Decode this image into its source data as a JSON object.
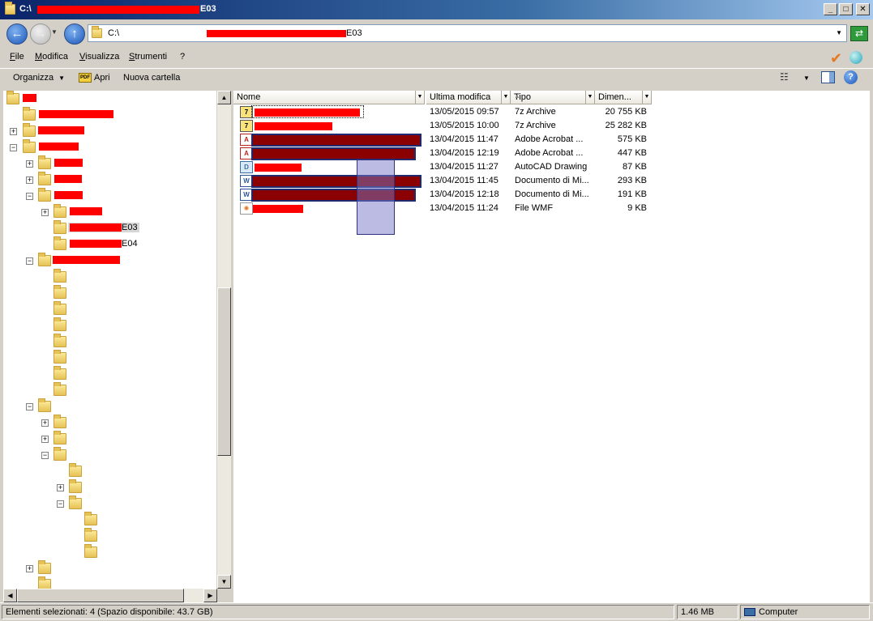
{
  "window": {
    "title_prefix": "C:\\",
    "title_suffix": "E03",
    "minimize": "_",
    "maximize": "□",
    "close": "✕"
  },
  "address": {
    "prefix": "C:\\",
    "suffix": "E03"
  },
  "menu": {
    "items": [
      "File",
      "Modifica",
      "Visualizza",
      "Strumenti",
      "?"
    ]
  },
  "toolbar": {
    "organize": "Organizza",
    "open": "Apri",
    "new_folder": "Nuova cartella"
  },
  "tree": {
    "e03_suffix": "E03",
    "e04_suffix": "E04"
  },
  "columns": {
    "name": "Nome",
    "modified": "Ultima modifica",
    "type": "Tipo",
    "size": "Dimen..."
  },
  "files": [
    {
      "date": "13/05/2015 09:57",
      "type": "7z Archive",
      "size": "20 755 KB",
      "icon": "archive-icon"
    },
    {
      "date": "13/05/2015 10:00",
      "type": "7z Archive",
      "size": "25 282 KB",
      "icon": "archive-icon"
    },
    {
      "date": "13/04/2015 11:47",
      "type": "Adobe Acrobat ...",
      "size": "575 KB",
      "icon": "pdf-icon"
    },
    {
      "date": "13/04/2015 12:19",
      "type": "Adobe Acrobat ...",
      "size": "447 KB",
      "icon": "pdf-icon"
    },
    {
      "date": "13/04/2015 11:27",
      "type": "AutoCAD Drawing",
      "size": "87 KB",
      "icon": "dwg-icon"
    },
    {
      "date": "13/04/2015 11:45",
      "type": "Documento di Mi...",
      "size": "293 KB",
      "icon": "word-icon"
    },
    {
      "date": "13/04/2015 12:18",
      "type": "Documento di Mi...",
      "size": "191 KB",
      "icon": "word-icon"
    },
    {
      "date": "13/04/2015 11:24",
      "type": "File WMF",
      "size": "9 KB",
      "icon": "wmf-icon"
    }
  ],
  "status": {
    "selection": "Elementi selezionati: 4 (Spazio disponibile: 43.7 GB)",
    "size": "1.46 MB",
    "location": "Computer"
  },
  "colors": {
    "redaction": "#ff0000",
    "selected_redaction": "#8b0000",
    "titlebar": "#0a246a"
  }
}
